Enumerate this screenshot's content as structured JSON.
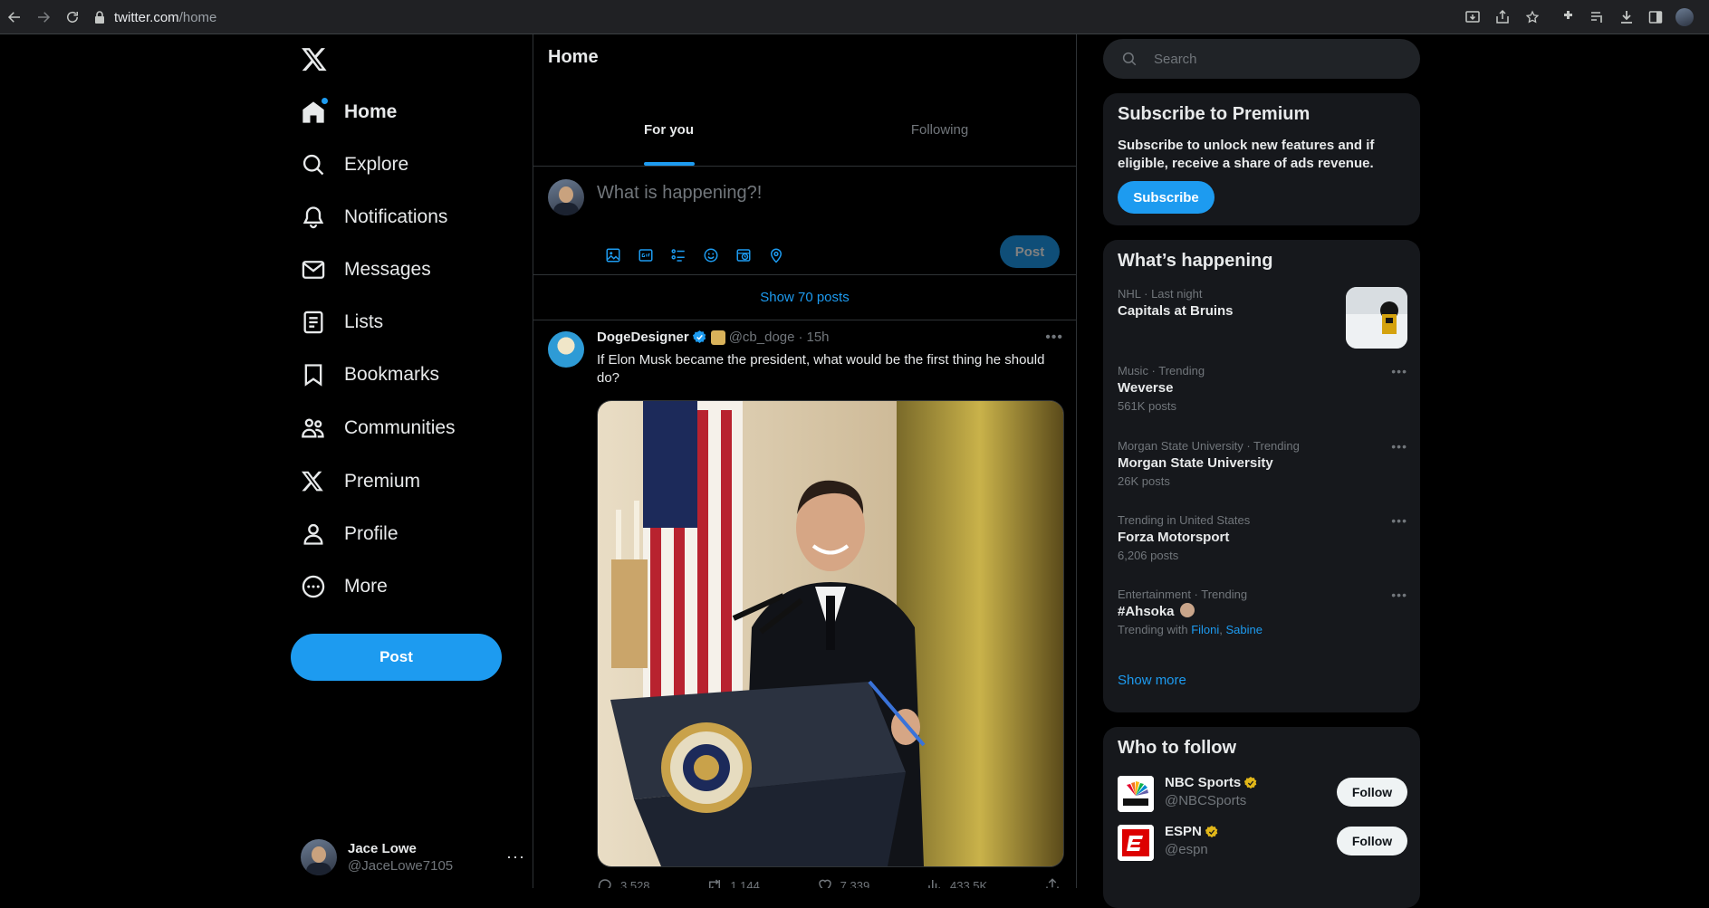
{
  "browser": {
    "url_host": "twitter.com",
    "url_path": "/home"
  },
  "sidebar": {
    "items": [
      {
        "label": "Home",
        "icon": "home-icon"
      },
      {
        "label": "Explore",
        "icon": "search-icon"
      },
      {
        "label": "Notifications",
        "icon": "bell-icon"
      },
      {
        "label": "Messages",
        "icon": "mail-icon"
      },
      {
        "label": "Lists",
        "icon": "list-icon"
      },
      {
        "label": "Bookmarks",
        "icon": "bookmark-icon"
      },
      {
        "label": "Communities",
        "icon": "people-icon"
      },
      {
        "label": "Premium",
        "icon": "x-logo-icon"
      },
      {
        "label": "Profile",
        "icon": "person-icon"
      },
      {
        "label": "More",
        "icon": "more-circle-icon"
      }
    ],
    "post_label": "Post",
    "account": {
      "name": "Jace Lowe",
      "handle": "@JaceLowe7105",
      "more": "···"
    }
  },
  "main": {
    "title": "Home",
    "tabs": [
      {
        "label": "For you"
      },
      {
        "label": "Following"
      }
    ],
    "composer": {
      "placeholder": "What is happening?!",
      "post_label": "Post"
    },
    "show_posts": "Show 70 posts",
    "tweet": {
      "name": "DogeDesigner",
      "handle": "@cb_doge",
      "sep": "·",
      "time": "15h",
      "text": "If Elon Musk became the president, what would be the first thing he should do?",
      "replies": "3,528",
      "reposts": "1,144",
      "likes": "7,339",
      "views": "433.5K"
    }
  },
  "right": {
    "search_placeholder": "Search",
    "premium": {
      "title": "Subscribe to Premium",
      "desc": "Subscribe to unlock new features and if eligible, receive a share of ads revenue.",
      "button": "Subscribe"
    },
    "trends": {
      "title": "What’s happening",
      "items": [
        {
          "context": "NHL · Last night",
          "title": "Capitals at Bruins",
          "count": ""
        },
        {
          "context": "Music · Trending",
          "title": "Weverse",
          "count": "561K posts"
        },
        {
          "context": "Morgan State University · Trending",
          "title": "Morgan State University",
          "count": "26K posts"
        },
        {
          "context": "Trending in United States",
          "title": "Forza Motorsport",
          "count": "6,206 posts"
        },
        {
          "context": "Entertainment · Trending",
          "title": "#Ahsoka",
          "count": ""
        }
      ],
      "trending_with_prefix": "Trending with",
      "trending_with_1": "Filoni",
      "trending_with_sep": ",",
      "trending_with_2": "Sabine",
      "show_more": "Show more"
    },
    "who_to_follow": {
      "title": "Who to follow",
      "accounts": [
        {
          "name": "NBC Sports",
          "handle": "@NBCSports",
          "button": "Follow"
        },
        {
          "name": "ESPN",
          "handle": "@espn",
          "button": "Follow"
        }
      ]
    }
  },
  "colors": {
    "accent": "#1d9bf0",
    "background": "#000000",
    "card": "#16181c",
    "muted": "#71767b"
  }
}
